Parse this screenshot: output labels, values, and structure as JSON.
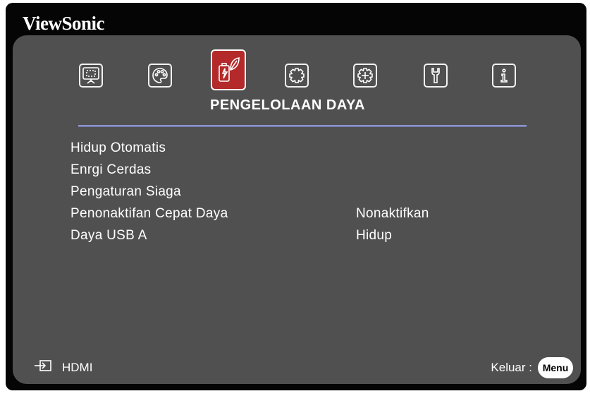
{
  "brand": "ViewSonic",
  "tabs": [
    {
      "name": "display-icon",
      "active": false
    },
    {
      "name": "palette-icon",
      "active": false
    },
    {
      "name": "power-eco-icon",
      "active": true
    },
    {
      "name": "settings-gear-icon",
      "active": false
    },
    {
      "name": "advanced-gear-icon",
      "active": false
    },
    {
      "name": "wrench-icon",
      "active": false
    },
    {
      "name": "info-icon",
      "active": false
    }
  ],
  "section_title": "PENGELOLAAN DAYA",
  "menu": [
    {
      "label": "Hidup Otomatis",
      "value": ""
    },
    {
      "label": "Enrgi Cerdas",
      "value": ""
    },
    {
      "label": "Pengaturan Siaga",
      "value": ""
    },
    {
      "label": "Penonaktifan Cepat Daya",
      "value": "Nonaktifkan"
    },
    {
      "label": "Daya USB A",
      "value": "Hidup"
    }
  ],
  "footer": {
    "source_icon": "input-source-icon",
    "source_label": "HDMI",
    "exit_label": "Keluar :",
    "menu_button": "Menu"
  },
  "colors": {
    "panel": "#505050",
    "active_tab": "#b42a2a",
    "divider": "#8a8fca"
  }
}
